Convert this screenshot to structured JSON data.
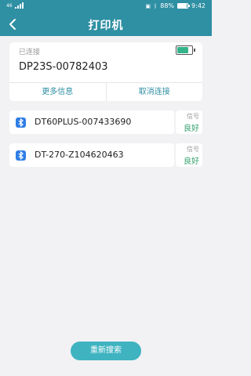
{
  "status_bar": {
    "left_indicator": "46",
    "battery_percent": "88%",
    "time": "9:42"
  },
  "app_bar": {
    "title": "打印机"
  },
  "connected": {
    "label": "已连接",
    "device_name": "DP23S-00782403",
    "battery_level": 0.8,
    "more_info_label": "更多信息",
    "disconnect_label": "取消连接"
  },
  "devices": [
    {
      "name": "DT60PLUS-007433690",
      "signal_label": "信号",
      "signal_value": "良好"
    },
    {
      "name": "DT-270-Z104620463",
      "signal_label": "信号",
      "signal_value": "良好"
    }
  ],
  "rescan_label": "重新搜索",
  "colors": {
    "header": "#2f8fa3",
    "accent": "#2f8fa3",
    "good": "#34a06b",
    "bluetooth": "#2f7ee6",
    "button": "#3fb3c0"
  }
}
